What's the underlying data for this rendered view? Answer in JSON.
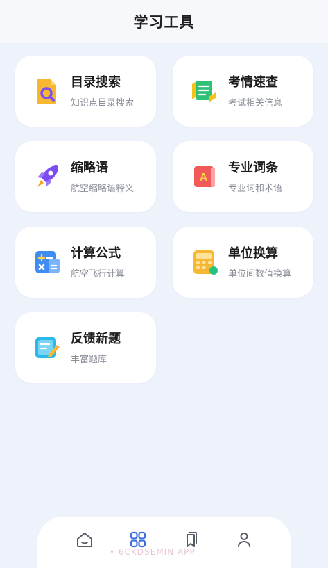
{
  "header": {
    "title": "学习工具"
  },
  "tools": [
    {
      "title": "目录搜索",
      "subtitle": "知识点目录搜索",
      "icon": "search-document-icon"
    },
    {
      "title": "考情速查",
      "subtitle": "考试相关信息",
      "icon": "exam-info-icon"
    },
    {
      "title": "缩略语",
      "subtitle": "航空缩略语释义",
      "icon": "rocket-icon"
    },
    {
      "title": "专业词条",
      "subtitle": "专业词和术语",
      "icon": "dictionary-icon"
    },
    {
      "title": "计算公式",
      "subtitle": "航空飞行计算",
      "icon": "formula-icon"
    },
    {
      "title": "单位换算",
      "subtitle": "单位间数值换算",
      "icon": "calculator-icon"
    },
    {
      "title": "反馈新题",
      "subtitle": "丰富题库",
      "icon": "feedback-edit-icon"
    }
  ],
  "tabbar": {
    "items": [
      {
        "name": "home",
        "icon": "home-icon",
        "active": false
      },
      {
        "name": "tools",
        "icon": "grid-icon",
        "active": true
      },
      {
        "name": "bookmarks",
        "icon": "bookmark-icon",
        "active": false
      },
      {
        "name": "profile",
        "icon": "user-icon",
        "active": false
      }
    ],
    "active_color": "#3d6fe0",
    "inactive_color": "#555a66"
  },
  "watermark": "• 6CKDSEMIN APP"
}
